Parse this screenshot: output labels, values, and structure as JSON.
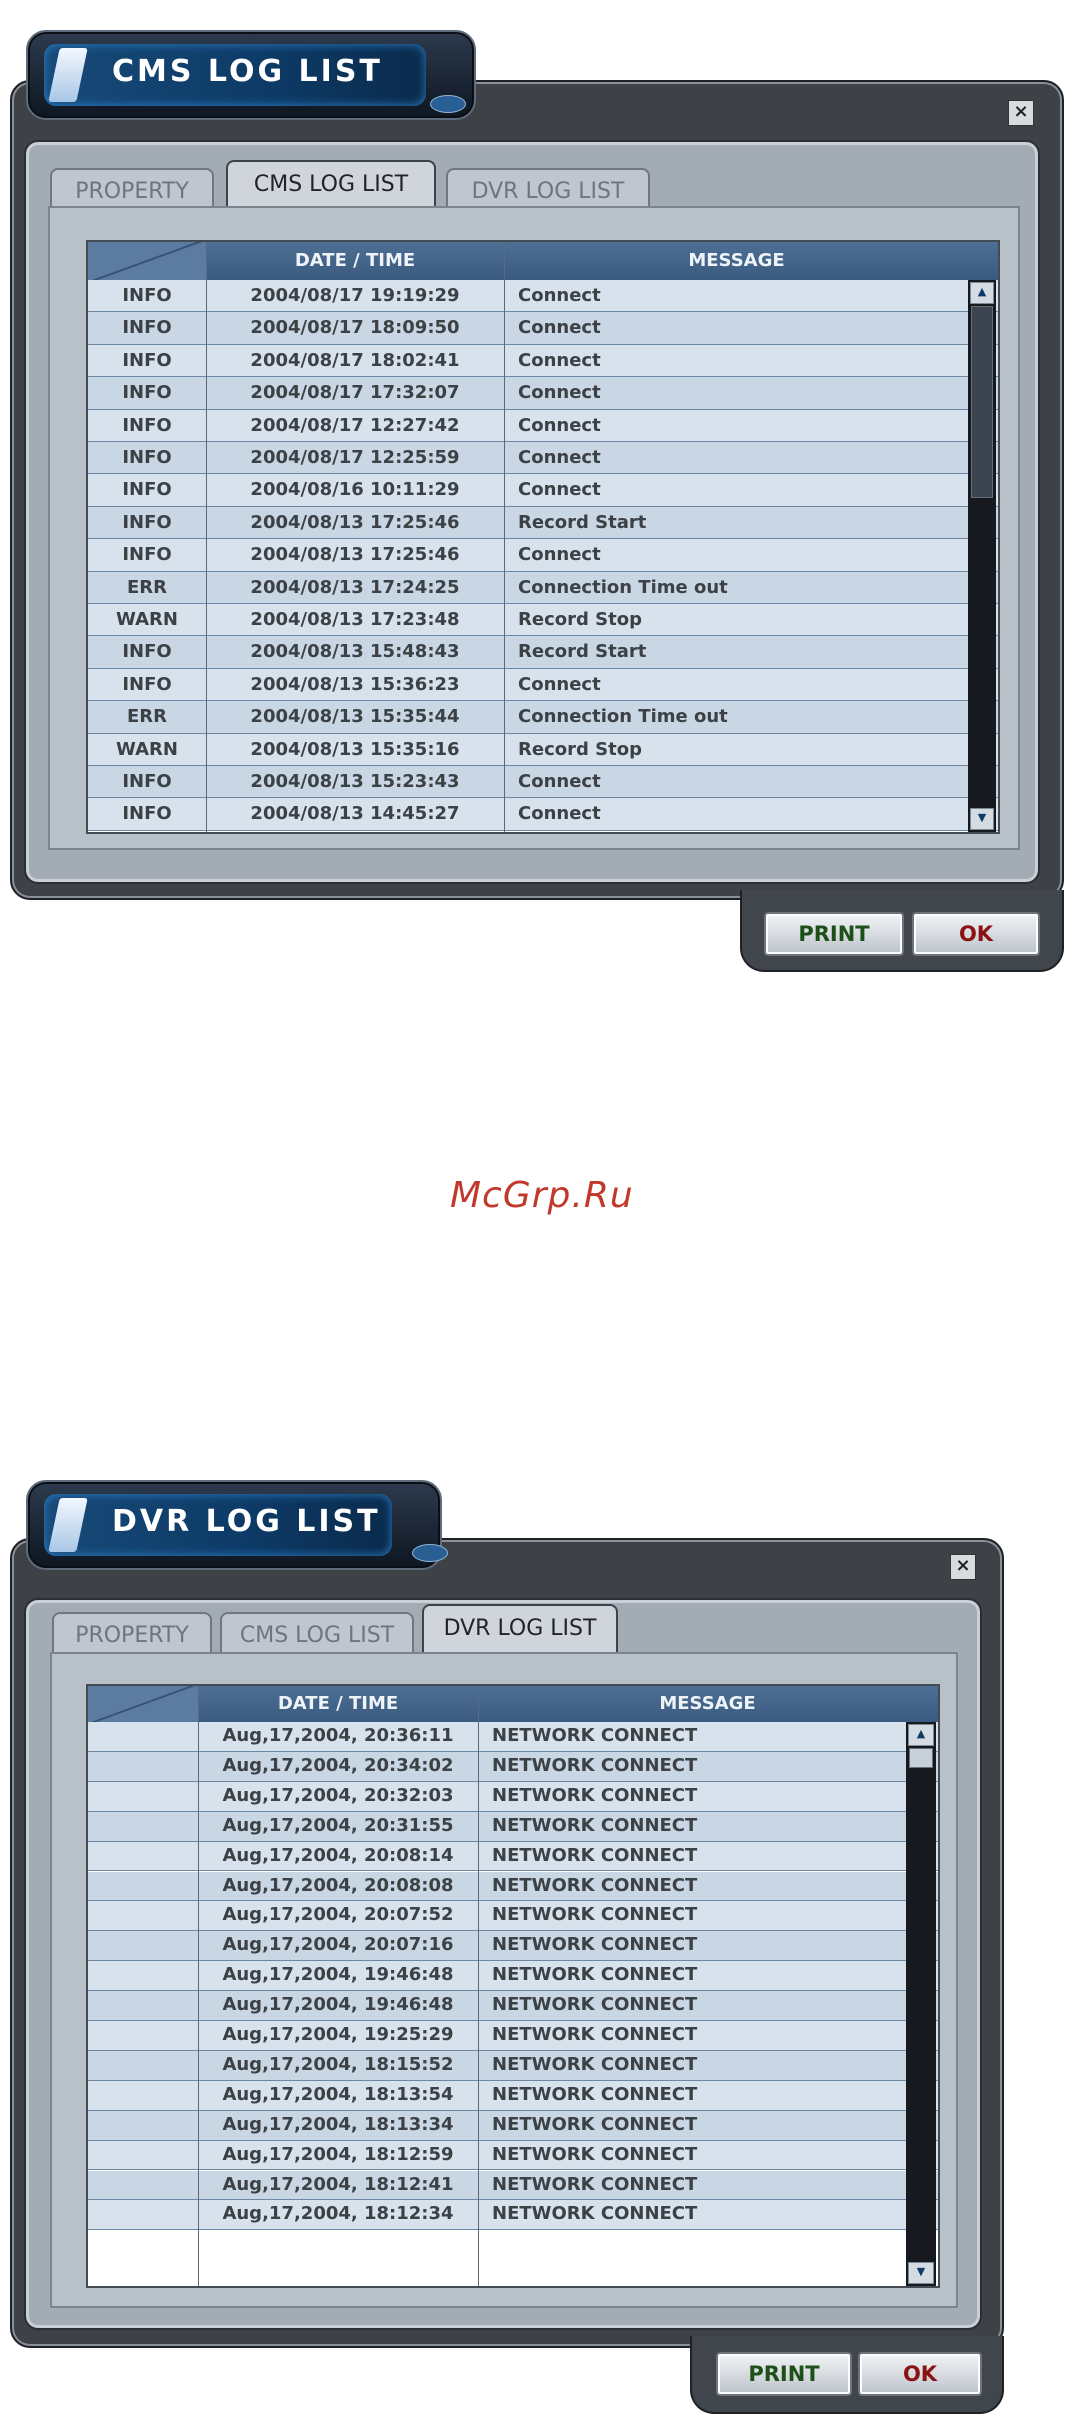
{
  "cms": {
    "title": "CMS LOG LIST",
    "close_label": "×",
    "tabs": [
      "PROPERTY",
      "CMS LOG LIST",
      "DVR LOG LIST"
    ],
    "active_tab": 1,
    "columns": [
      "DATE / TIME",
      "MESSAGE"
    ],
    "rows": [
      [
        "INFO",
        "2004/08/17 19:19:29",
        "Connect"
      ],
      [
        "INFO",
        "2004/08/17 18:09:50",
        "Connect"
      ],
      [
        "INFO",
        "2004/08/17 18:02:41",
        "Connect"
      ],
      [
        "INFO",
        "2004/08/17 17:32:07",
        "Connect"
      ],
      [
        "INFO",
        "2004/08/17 12:27:42",
        "Connect"
      ],
      [
        "INFO",
        "2004/08/17 12:25:59",
        "Connect"
      ],
      [
        "INFO",
        "2004/08/16 10:11:29",
        "Connect"
      ],
      [
        "INFO",
        "2004/08/13 17:25:46",
        "Record Start"
      ],
      [
        "INFO",
        "2004/08/13 17:25:46",
        "Connect"
      ],
      [
        "ERR",
        "2004/08/13 17:24:25",
        "Connection Time out"
      ],
      [
        "WARN",
        "2004/08/13 17:23:48",
        "Record Stop"
      ],
      [
        "INFO",
        "2004/08/13 15:48:43",
        "Record Start"
      ],
      [
        "INFO",
        "2004/08/13 15:36:23",
        "Connect"
      ],
      [
        "ERR",
        "2004/08/13 15:35:44",
        "Connection Time out"
      ],
      [
        "WARN",
        "2004/08/13 15:35:16",
        "Record Stop"
      ],
      [
        "INFO",
        "2004/08/13 15:23:43",
        "Connect"
      ],
      [
        "INFO",
        "2004/08/13 14:45:27",
        "Connect"
      ]
    ],
    "scroll_up": "▲",
    "scroll_down": "▼",
    "print_label": "PRINT",
    "ok_label": "OK"
  },
  "watermark": "McGrp.Ru",
  "dvr": {
    "title": "DVR LOG LIST",
    "close_label": "×",
    "tabs": [
      "PROPERTY",
      "CMS LOG LIST",
      "DVR LOG LIST"
    ],
    "active_tab": 2,
    "columns": [
      "DATE / TIME",
      "MESSAGE"
    ],
    "rows": [
      [
        "",
        "Aug,17,2004, 20:36:11",
        "NETWORK CONNECT"
      ],
      [
        "",
        "Aug,17,2004, 20:34:02",
        "NETWORK CONNECT"
      ],
      [
        "",
        "Aug,17,2004, 20:32:03",
        "NETWORK CONNECT"
      ],
      [
        "",
        "Aug,17,2004, 20:31:55",
        "NETWORK CONNECT"
      ],
      [
        "",
        "Aug,17,2004, 20:08:14",
        "NETWORK CONNECT"
      ],
      [
        "",
        "Aug,17,2004, 20:08:08",
        "NETWORK CONNECT"
      ],
      [
        "",
        "Aug,17,2004, 20:07:52",
        "NETWORK CONNECT"
      ],
      [
        "",
        "Aug,17,2004, 20:07:16",
        "NETWORK CONNECT"
      ],
      [
        "",
        "Aug,17,2004, 19:46:48",
        "NETWORK CONNECT"
      ],
      [
        "",
        "Aug,17,2004, 19:46:48",
        "NETWORK CONNECT"
      ],
      [
        "",
        "Aug,17,2004, 19:25:29",
        "NETWORK CONNECT"
      ],
      [
        "",
        "Aug,17,2004, 18:15:52",
        "NETWORK CONNECT"
      ],
      [
        "",
        "Aug,17,2004, 18:13:54",
        "NETWORK CONNECT"
      ],
      [
        "",
        "Aug,17,2004, 18:13:34",
        "NETWORK CONNECT"
      ],
      [
        "",
        "Aug,17,2004, 18:12:59",
        "NETWORK CONNECT"
      ],
      [
        "",
        "Aug,17,2004, 18:12:41",
        "NETWORK CONNECT"
      ],
      [
        "",
        "Aug,17,2004, 18:12:34",
        "NETWORK CONNECT"
      ]
    ],
    "scroll_up": "▲",
    "scroll_down": "▼",
    "print_label": "PRINT",
    "ok_label": "OK"
  }
}
